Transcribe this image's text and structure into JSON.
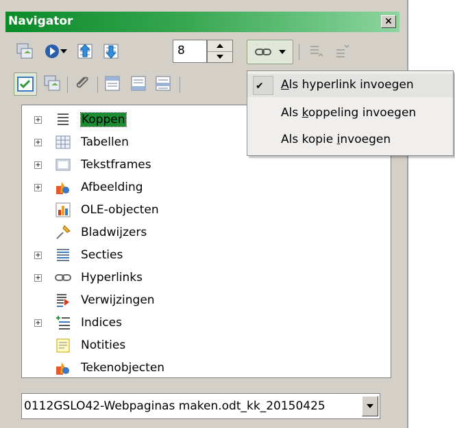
{
  "window": {
    "title": "Navigator",
    "close_glyph": "×"
  },
  "toolbar": {
    "chapter_level": "8",
    "icons": [
      "toggle-icon",
      "navigation-icon",
      "promote-icon",
      "demote-icon",
      "drag-mode-icon",
      "promote-chapter-icon",
      "demote-chapter-icon",
      "list-box-icon",
      "content-view-icon",
      "set-reminder-icon",
      "header-icon",
      "footer-icon",
      "anchor-icon"
    ]
  },
  "drag_menu": {
    "items": [
      {
        "pre": "",
        "accel": "A",
        "post": "ls hyperlink invoegen",
        "checked": true
      },
      {
        "pre": "Als ",
        "accel": "k",
        "post": "oppeling invoegen",
        "checked": false
      },
      {
        "pre": "Als kopie ",
        "accel": "i",
        "post": "nvoegen",
        "checked": false
      }
    ]
  },
  "tree": {
    "items": [
      {
        "label": "Koppen",
        "expandable": true,
        "selected": true,
        "icon": "headings-icon"
      },
      {
        "label": "Tabellen",
        "expandable": true,
        "icon": "tables-icon"
      },
      {
        "label": "Tekstframes",
        "expandable": true,
        "icon": "text-frames-icon"
      },
      {
        "label": "Afbeelding",
        "expandable": true,
        "icon": "images-icon"
      },
      {
        "label": "OLE-objecten",
        "expandable": false,
        "icon": "ole-objects-icon"
      },
      {
        "label": "Bladwijzers",
        "expandable": false,
        "icon": "bookmarks-icon"
      },
      {
        "label": "Secties",
        "expandable": true,
        "icon": "sections-icon"
      },
      {
        "label": "Hyperlinks",
        "expandable": true,
        "icon": "hyperlinks-icon"
      },
      {
        "label": "Verwijzingen",
        "expandable": false,
        "icon": "references-icon"
      },
      {
        "label": "Indices",
        "expandable": true,
        "icon": "indexes-icon"
      },
      {
        "label": "Notities",
        "expandable": false,
        "icon": "comments-icon"
      },
      {
        "label": "Tekenobjecten",
        "expandable": false,
        "icon": "drawing-objects-icon"
      }
    ],
    "expand_glyph": "+"
  },
  "document_select": {
    "value": "0112GSLO42-Webpaginas maken.odt_kk_20150425"
  },
  "colors": {
    "title_start": "#0a8a29",
    "selection": "#1c8c32",
    "menu_bg": "#f0efed"
  }
}
